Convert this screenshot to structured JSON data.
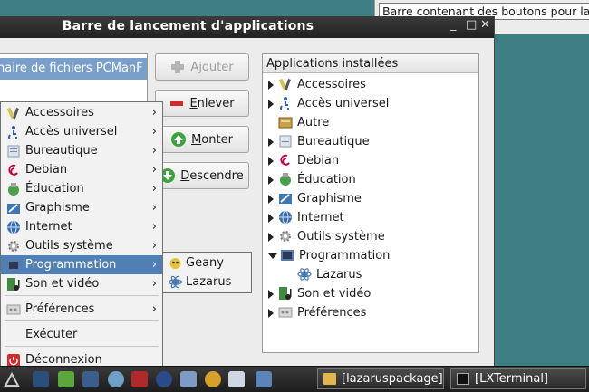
{
  "background_window": {
    "tooltip": "Barre contenant des boutons pour la"
  },
  "dialog": {
    "title": "Barre de lancement d'applications",
    "controls": {
      "minimize": "_",
      "maximize": "□",
      "close": "✕"
    },
    "left_list": {
      "selected_item": "naire de fichiers PCManF"
    },
    "buttons": {
      "add": {
        "label": "Ajouter",
        "underline": "A"
      },
      "remove": {
        "label": "nlever",
        "underline": "E"
      },
      "up": {
        "label": "onter",
        "underline": "M"
      },
      "down": {
        "label": "escendre",
        "underline": "D"
      }
    },
    "tree": {
      "header": "Applications installées",
      "items": [
        {
          "label": "Accessoires",
          "expander": "right",
          "icon": "accessories-icon"
        },
        {
          "label": "Accès universel",
          "expander": "right",
          "icon": "accessibility-icon"
        },
        {
          "label": "Autre",
          "expander": "none",
          "icon": "other-icon"
        },
        {
          "label": "Bureautique",
          "expander": "right",
          "icon": "office-icon"
        },
        {
          "label": "Debian",
          "expander": "right",
          "icon": "debian-icon"
        },
        {
          "label": "Éducation",
          "expander": "right",
          "icon": "education-icon"
        },
        {
          "label": "Graphisme",
          "expander": "right",
          "icon": "graphics-icon"
        },
        {
          "label": "Internet",
          "expander": "right",
          "icon": "internet-icon"
        },
        {
          "label": "Outils système",
          "expander": "right",
          "icon": "system-tools-icon"
        },
        {
          "label": "Programmation",
          "expander": "down",
          "icon": "programming-icon"
        },
        {
          "label": "Lazarus",
          "expander": "child",
          "icon": "lazarus-icon"
        },
        {
          "label": "Son et vidéo",
          "expander": "right",
          "icon": "multimedia-icon"
        },
        {
          "label": "Préférences",
          "expander": "right",
          "icon": "preferences-icon"
        }
      ]
    }
  },
  "menu": {
    "items": [
      {
        "label": "Accessoires",
        "submenu": true
      },
      {
        "label": "Accès universel",
        "submenu": true
      },
      {
        "label": "Bureautique",
        "submenu": true
      },
      {
        "label": "Debian",
        "submenu": true
      },
      {
        "label": "Éducation",
        "submenu": true
      },
      {
        "label": "Graphisme",
        "submenu": true
      },
      {
        "label": "Internet",
        "submenu": true
      },
      {
        "label": "Outils système",
        "submenu": true
      },
      {
        "label": "Programmation",
        "submenu": true,
        "active": true
      },
      {
        "label": "Son et vidéo",
        "submenu": true
      },
      {
        "label": "Préférences",
        "submenu": true
      },
      {
        "label": "Exécuter",
        "submenu": false
      },
      {
        "label": "Déconnexion",
        "submenu": false
      }
    ],
    "submenu": [
      {
        "label": "Geany"
      },
      {
        "label": "Lazarus"
      }
    ]
  },
  "taskbar": {
    "tasks": [
      {
        "label": "[lazaruspackage]",
        "icon": "folder-icon"
      },
      {
        "label": "[LXTerminal]",
        "icon": "terminal-icon"
      }
    ]
  },
  "colors": {
    "desktop": "#3e7f83",
    "menu_highlight": "#4f7fb4",
    "list_selection": "#7a9fcb",
    "titlebar": "#2a2a2a"
  }
}
